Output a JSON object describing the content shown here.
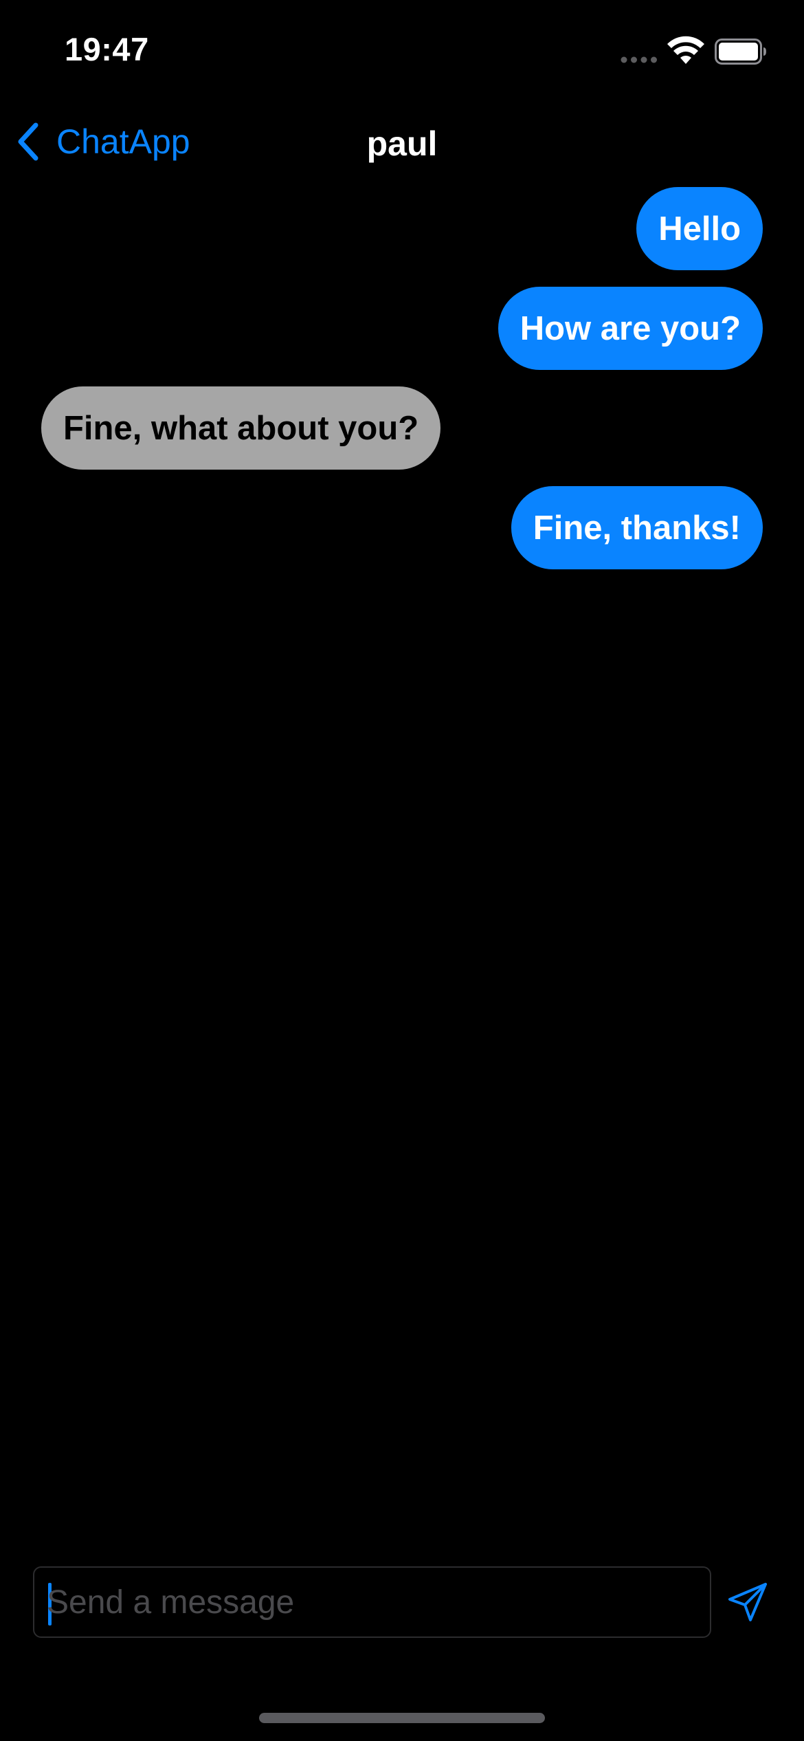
{
  "status_bar": {
    "time": "19:47",
    "icons": [
      "cellular-signal-icon",
      "wifi-icon",
      "battery-icon"
    ]
  },
  "nav": {
    "back_label": "ChatApp",
    "title": "paul",
    "back_icon": "chevron-left-icon"
  },
  "messages": [
    {
      "text": "Hello",
      "direction": "sent"
    },
    {
      "text": "How are you?",
      "direction": "sent"
    },
    {
      "text": "Fine, what about you?",
      "direction": "received"
    },
    {
      "text": "Fine, thanks!",
      "direction": "sent"
    }
  ],
  "composer": {
    "placeholder": "Send a message",
    "value": "",
    "send_icon": "paper-plane-icon"
  },
  "colors": {
    "accent": "#0a84ff",
    "sent_bubble": "#0a84ff",
    "received_bubble": "#a6a6a6",
    "background": "#000000"
  }
}
